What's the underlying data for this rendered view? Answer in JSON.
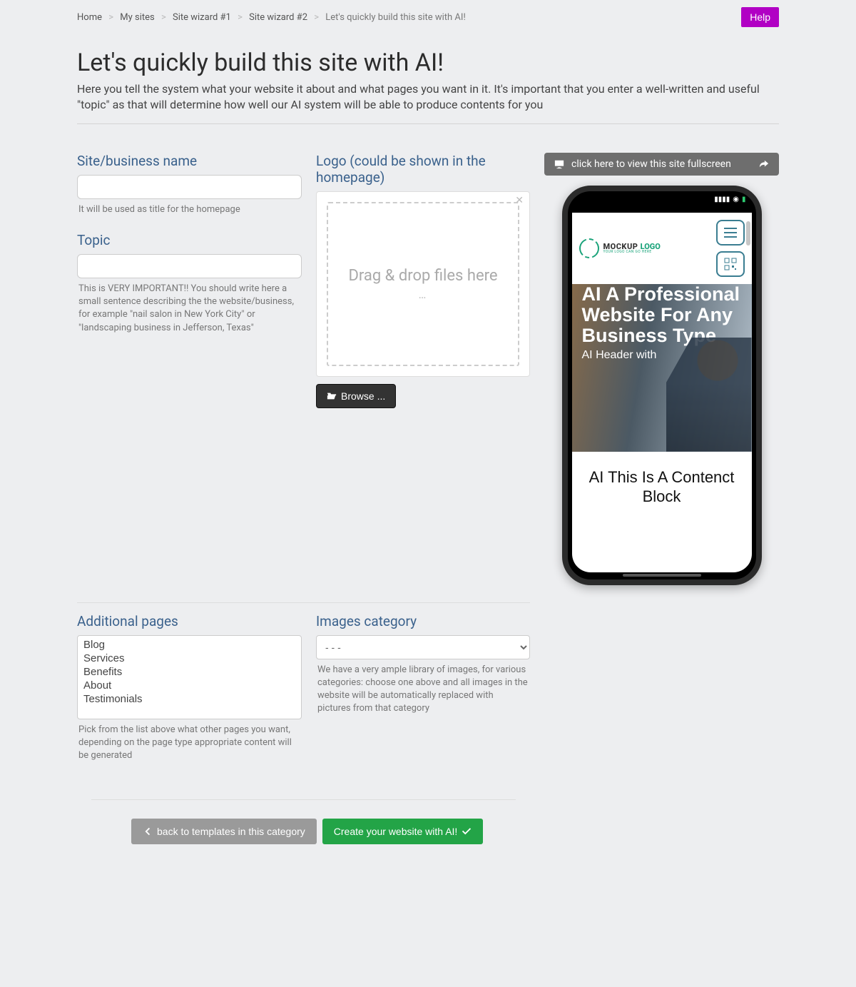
{
  "breadcrumb": {
    "items": [
      {
        "label": "Home"
      },
      {
        "label": "My sites"
      },
      {
        "label": "Site wizard #1"
      },
      {
        "label": "Site wizard #2"
      },
      {
        "label": "Let's quickly build this site with AI!"
      }
    ]
  },
  "help_button": "Help",
  "page": {
    "title": "Let's quickly build this site with AI!",
    "description": "Here you tell the system what your website it about and what pages you want in it. It's important that you enter a well-written and useful \"topic\" as that will determine how well our AI system will be able to produce contents for you"
  },
  "site_name": {
    "label": "Site/business name",
    "value": "",
    "help": "It will be used as title for the homepage"
  },
  "topic": {
    "label": "Topic",
    "value": "",
    "help": "This is VERY IMPORTANT!! You should write here a small sentence describing the the website/business, for example \"nail salon in New York City\" or \"landscaping business in Jefferson, Texas\""
  },
  "logo": {
    "label": "Logo (could be shown in the homepage)",
    "dropzone_text": "Drag & drop files here",
    "dropzone_ellipsis": "…",
    "browse_label": "Browse ..."
  },
  "additional_pages": {
    "label": "Additional pages",
    "options": [
      "Blog",
      "Services",
      "Benefits",
      "About",
      "Testimonials"
    ],
    "help": "Pick from the list above what other pages you want, depending on the page type appropriate content will be generated"
  },
  "images_category": {
    "label": "Images category",
    "selected": "- - -",
    "help": "We have a very ample library of images, for various categories: choose one above and all images in the website will be automatically replaced with pictures from that category"
  },
  "fullscreen_bar": "click here to view this site fullscreen",
  "preview": {
    "logo_main": "MOCKUP ",
    "logo_accent": "LOGO",
    "logo_sub": "YOUR LOGO CAN GO HERE",
    "hero_title": "AI A Professional Website For Any Business Type",
    "hero_sub": "AI Header with",
    "content_title": "AI This Is A Contenct Block"
  },
  "actions": {
    "back": "back to templates in this category",
    "create": "Create your website with AI!"
  }
}
